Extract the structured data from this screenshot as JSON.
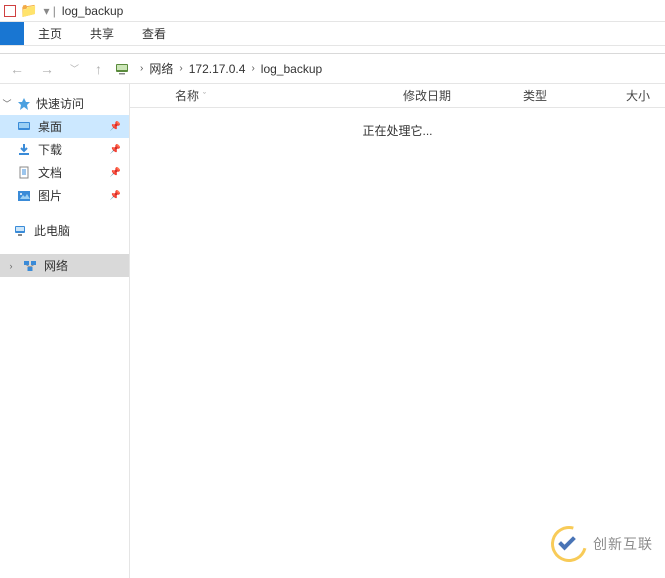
{
  "titlebar": {
    "folder_name": "log_backup"
  },
  "menu": {
    "home": "主页",
    "share": "共享",
    "view": "查看"
  },
  "breadcrumb": {
    "network": "网络",
    "ip": "172.17.0.4",
    "folder": "log_backup"
  },
  "sidebar": {
    "quick_access": "快速访问",
    "desktop": "桌面",
    "downloads": "下载",
    "documents": "文档",
    "pictures": "图片",
    "this_pc": "此电脑",
    "network": "网络"
  },
  "columns": {
    "name": "名称",
    "date": "修改日期",
    "type": "类型",
    "size": "大小"
  },
  "content": {
    "status": "正在处理它..."
  },
  "watermark": {
    "text": "创新互联"
  }
}
